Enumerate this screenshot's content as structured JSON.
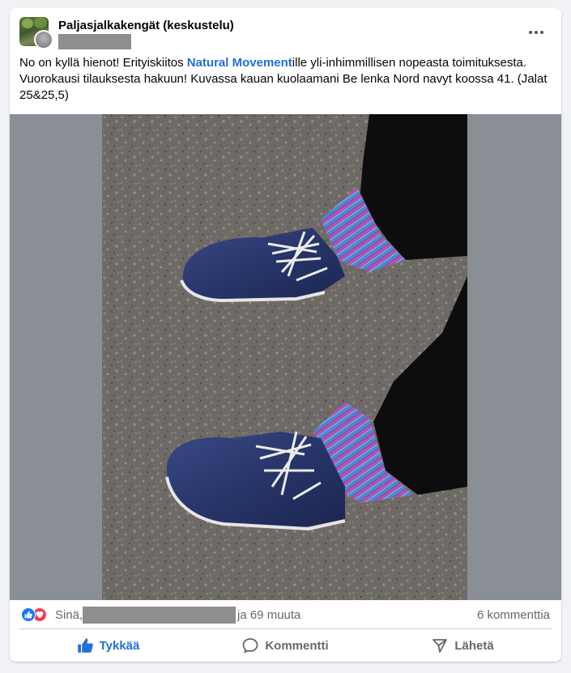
{
  "post": {
    "group_name": "Paljasjalkakengät (keskustelu)",
    "text_before_link": "No on kyllä hienot! Erityiskiitos ",
    "link_text": "Natural Movement",
    "text_after_link": "ille yli-inhimmillisen nopeasta toimituksesta. Vuorokausi tilauksesta hakuun! Kuvassa kauan kuolaamani Be lenka Nord navyt koossa 41. (Jalat 25&25,5)",
    "more_icon": "more-horizontal-icon"
  },
  "reactions": {
    "you_label": "Sinä,",
    "others_label": "ja 69 muuta",
    "comments_count": "6 kommenttia",
    "icons": [
      "like-reaction-icon",
      "love-reaction-icon"
    ]
  },
  "actions": {
    "like_label": "Tykkää",
    "comment_label": "Kommentti",
    "share_label": "Lähetä"
  },
  "colors": {
    "link": "#216fdb",
    "like_active": "#216fdb",
    "like_reaction": "#1877f2",
    "love_reaction": "#f33e58",
    "secondary_text": "#65676b"
  }
}
